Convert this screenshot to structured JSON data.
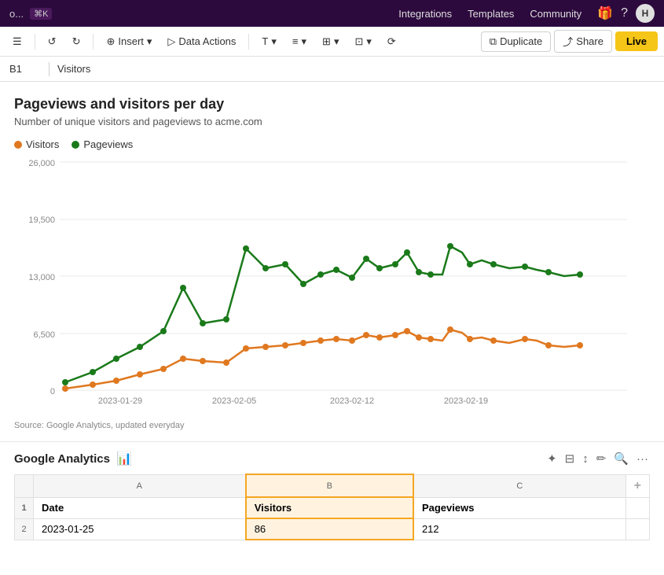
{
  "topnav": {
    "filename": "o...",
    "shortcut": "⌘K",
    "links": [
      {
        "label": "Integrations",
        "name": "integrations-link"
      },
      {
        "label": "Templates",
        "name": "templates-link"
      },
      {
        "label": "Community",
        "name": "community-link"
      }
    ],
    "avatar_label": "H"
  },
  "toolbar": {
    "sidebar_toggle": "☰",
    "undo": "↺",
    "redo": "↻",
    "insert_label": "Insert",
    "data_actions_label": "Data Actions",
    "text_format_label": "T",
    "align_label": "≡",
    "cell_format_label": "⊞",
    "merge_label": "⊡",
    "chart_icon": "⟳",
    "duplicate_label": "Duplicate",
    "share_label": "Share",
    "live_label": "Live"
  },
  "cellbar": {
    "ref": "B1",
    "value": "Visitors"
  },
  "chart": {
    "title": "Pageviews and visitors per day",
    "subtitle": "Number of unique visitors and pageviews to acme.com",
    "legend": [
      {
        "label": "Visitors",
        "color": "#e07820"
      },
      {
        "label": "Pageviews",
        "color": "#1a7a1a"
      }
    ],
    "y_axis": [
      "26,000",
      "19,500",
      "13,000",
      "6,500",
      "0"
    ],
    "x_axis": [
      "2023-01-29",
      "2023-02-05",
      "2023-02-12",
      "2023-02-19"
    ],
    "source": "Source: Google Analytics, updated everyday"
  },
  "google_analytics": {
    "title": "Google Analytics",
    "icon": "📊",
    "table": {
      "columns": [
        {
          "letter": "A"
        },
        {
          "letter": "B"
        },
        {
          "letter": "C"
        },
        {
          "letter": "+"
        }
      ],
      "headers": [
        "Date",
        "Visitors",
        "Pageviews"
      ],
      "rows": [
        {
          "num": "2",
          "date": "2023-01-25",
          "visitors": "86",
          "pageviews": "212"
        }
      ]
    }
  }
}
